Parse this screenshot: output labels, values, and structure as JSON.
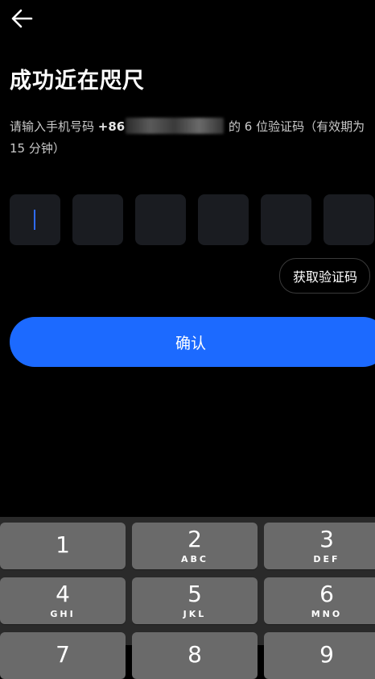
{
  "header": {
    "back_icon": "arrow-left-icon"
  },
  "title": "成功近在咫尺",
  "description": {
    "before": "请输入手机号码 ",
    "phone_prefix": "+86",
    "after": " 的 6 位验证码（有效期为 15 分钟）"
  },
  "code_input": {
    "digits": [
      "",
      "",
      "",
      "",
      "",
      ""
    ]
  },
  "get_code_label": "获取验证码",
  "confirm_label": "确认",
  "colors": {
    "accent": "#1c6aff",
    "background": "#000000",
    "box": "#1a1c21",
    "key": "#6a6a6a"
  },
  "keypad": {
    "keys": [
      {
        "num": "1",
        "letters": ""
      },
      {
        "num": "2",
        "letters": "ABC"
      },
      {
        "num": "3",
        "letters": "DEF"
      },
      {
        "num": "4",
        "letters": "GHI"
      },
      {
        "num": "5",
        "letters": "JKL"
      },
      {
        "num": "6",
        "letters": "MNO"
      },
      {
        "num": "7",
        "letters": ""
      },
      {
        "num": "8",
        "letters": ""
      },
      {
        "num": "9",
        "letters": ""
      }
    ]
  }
}
